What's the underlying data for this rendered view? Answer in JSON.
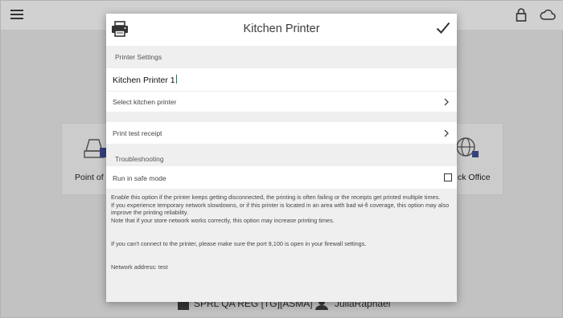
{
  "background": {
    "tiles": [
      {
        "label": "Point of S"
      },
      {
        "label": "ck Office"
      }
    ],
    "footer": {
      "store": "SPRL QA REG [TG][ASMA]",
      "user": "JuliaRaphael"
    }
  },
  "dialog": {
    "title": "Kitchen Printer",
    "sections": {
      "printer_settings": "Printer Settings",
      "troubleshooting": "Troubleshooting"
    },
    "printer_name": "Kitchen Printer 1",
    "select_printer": "Select kitchen printer",
    "print_test": "Print test receipt",
    "safe_mode": {
      "label": "Run in safe mode",
      "checked": false
    },
    "help": {
      "line1": "Enable this option if the printer keeps getting disconnected, the printing is often failing or the receipts get printed multiple times.",
      "line2": "If you experience temporary network slowdowns, or if this printer is located in an area with bad wi-fi coverage, this option may also improve the printing reliability.",
      "line3": "Note that if your store network works correctly, this option may increase printing times.",
      "port_note": "If you can't connect to the printer, please make sure the port 9,100 is open in your firewall settings.",
      "network_address": "Network address: test"
    }
  },
  "icons": {
    "menu": "hamburger-menu-icon",
    "lock": "lock-icon",
    "cloud": "cloud-icon",
    "printer": "printer-icon",
    "confirm": "checkmark-icon",
    "chevron": "chevron-right-icon"
  },
  "colors": {
    "caret": "#1a7a5a",
    "dialog_bg": "#efefef",
    "row_bg": "#ffffff"
  }
}
